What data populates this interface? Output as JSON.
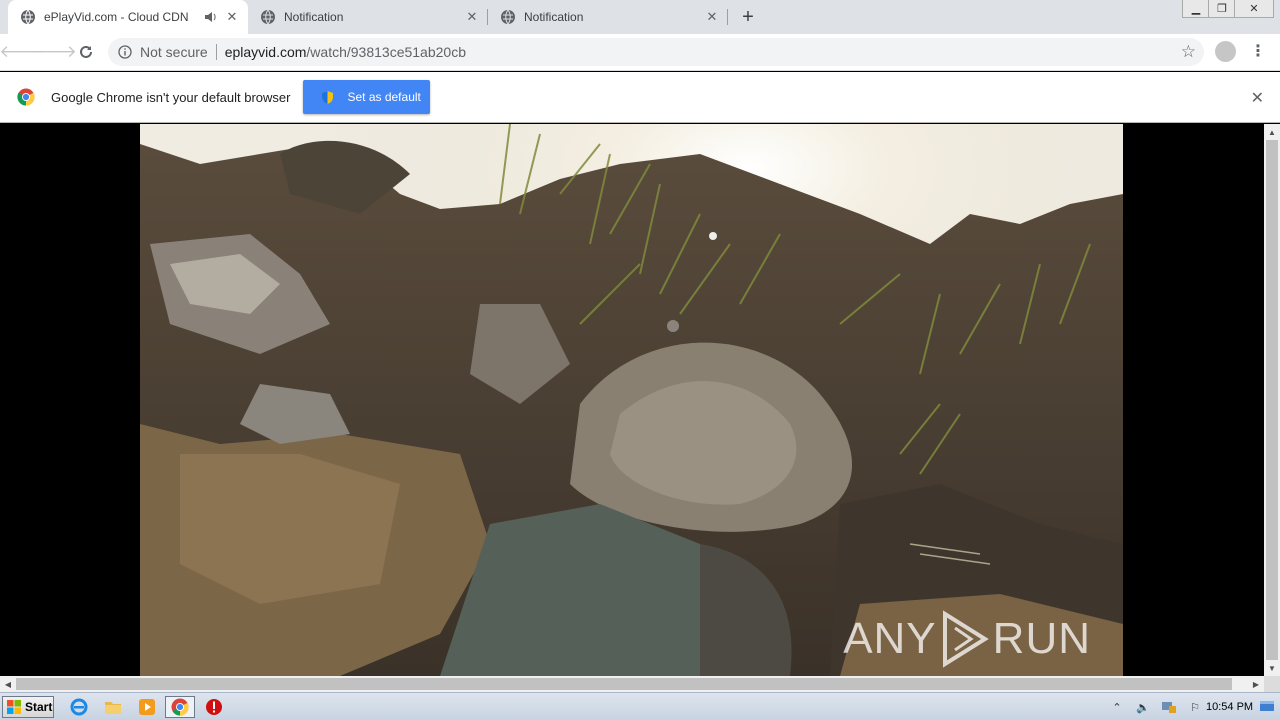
{
  "tabs": [
    {
      "title": "ePlayVid.com - Cloud CDN",
      "active": true,
      "audio": true
    },
    {
      "title": "Notification",
      "active": false
    },
    {
      "title": "Notification",
      "active": false
    }
  ],
  "toolbar": {
    "security_label": "Not secure",
    "url_host": "eplayvid.com",
    "url_path": "/watch/93813ce51ab20cb"
  },
  "infobar": {
    "message": "Google Chrome isn't your default browser",
    "button_label": "Set as default"
  },
  "video": {
    "description": "rocky soil embankment with grass, sun flare",
    "watermark_left": "ANY",
    "watermark_right": "RUN"
  },
  "taskbar": {
    "start_label": "Start",
    "clock": "10:54 PM"
  },
  "colors": {
    "accent": "#4285f4",
    "tabstrip": "#dee1e6"
  }
}
